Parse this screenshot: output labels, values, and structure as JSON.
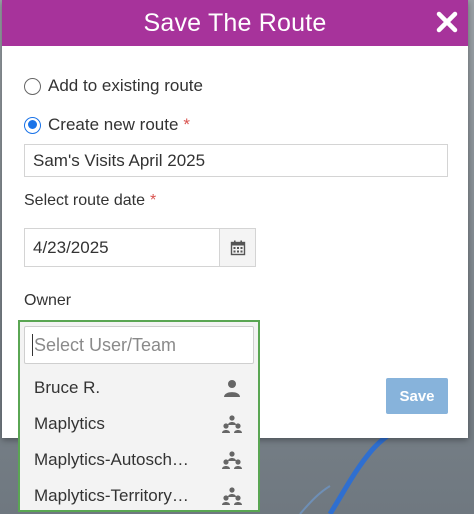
{
  "dialog": {
    "title": "Save The Route",
    "close_icon": "close-icon",
    "header_color": "#a7339b"
  },
  "options": {
    "add_existing_label": "Add to existing route",
    "create_new_label": "Create new route",
    "create_new_required": "*",
    "selected": "create_new"
  },
  "route_name": {
    "value": "Sam's Visits April 2025"
  },
  "route_date": {
    "label": "Select route date",
    "required": "*",
    "value": "4/23/2025",
    "calendar_icon": "calendar-icon"
  },
  "owner": {
    "label": "Owner",
    "search_placeholder": "Select User/Team",
    "items": [
      {
        "label": "Bruce R.",
        "icon": "user-icon"
      },
      {
        "label": "Maplytics",
        "icon": "team-icon"
      },
      {
        "label": "Maplytics-Autosch…",
        "icon": "team-icon"
      },
      {
        "label": "Maplytics-Territory…",
        "icon": "team-icon"
      }
    ]
  },
  "actions": {
    "save_label": "Save"
  }
}
